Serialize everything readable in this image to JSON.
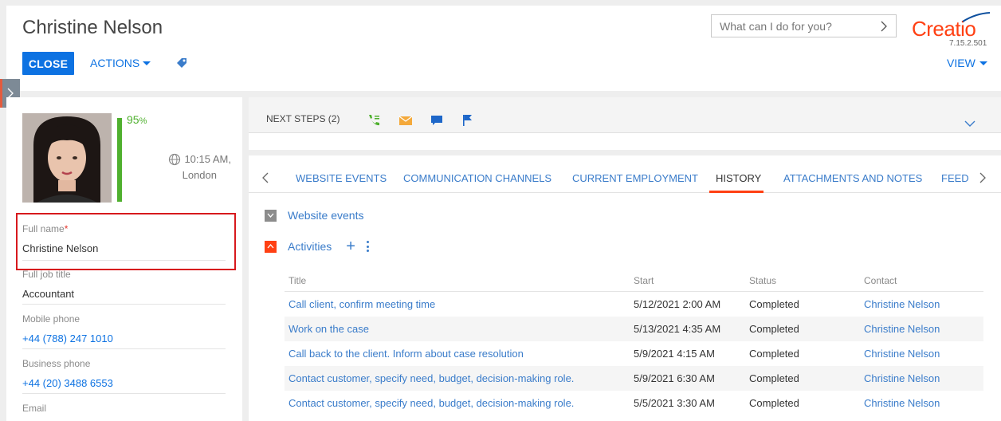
{
  "header": {
    "title": "Christine Nelson",
    "close_label": "CLOSE",
    "actions_label": "ACTIONS",
    "search_placeholder": "What can I do for you?",
    "logo_text": "Creatio",
    "version": "7.15.2.501",
    "view_label": "VIEW",
    "accent_color": "#0d72e2",
    "brand_color": "#ff4013"
  },
  "profile": {
    "completeness": "95",
    "percent_sign": "%",
    "completeness_fraction": 0.95,
    "time": "10:15 AM,",
    "city": "London",
    "fields": [
      {
        "label": "Full name",
        "required_mark": "*",
        "value": "Christine Nelson"
      },
      {
        "label": "Full job title",
        "value": "Accountant"
      },
      {
        "label": "Mobile phone",
        "value": "+44 (788) 247 1010"
      },
      {
        "label": "Business phone",
        "value": "+44 (20) 3488 6553"
      },
      {
        "label": "Email",
        "value": ""
      }
    ]
  },
  "next_steps": {
    "label": "NEXT STEPS (2)",
    "icons": [
      "call-icon",
      "email-icon",
      "chat-icon",
      "flag-icon"
    ]
  },
  "tabs": [
    {
      "label": "WEBSITE EVENTS"
    },
    {
      "label": "COMMUNICATION CHANNELS"
    },
    {
      "label": "CURRENT EMPLOYMENT"
    },
    {
      "label": "HISTORY",
      "active": true
    },
    {
      "label": "ATTACHMENTS AND NOTES"
    },
    {
      "label": "FEED"
    }
  ],
  "history": {
    "website_events_label": "Website events",
    "activities_label": "Activities",
    "columns": [
      "Title",
      "Start",
      "Status",
      "Contact"
    ],
    "rows": [
      {
        "title": "Call client, confirm meeting time",
        "start": "5/12/2021 2:00 AM",
        "status": "Completed",
        "contact": "Christine Nelson"
      },
      {
        "title": "Work on the case",
        "start": "5/13/2021 4:35 AM",
        "status": "Completed",
        "contact": "Christine Nelson"
      },
      {
        "title": "Call back to the client. Inform about case resolution",
        "start": "5/9/2021 4:15 AM",
        "status": "Completed",
        "contact": "Christine Nelson"
      },
      {
        "title": "Contact customer, specify need, budget, decision-making role.",
        "start": "5/9/2021 6:30 AM",
        "status": "Completed",
        "contact": "Christine Nelson"
      },
      {
        "title": "Contact customer, specify need, budget, decision-making role.",
        "start": "5/5/2021 3:30 AM",
        "status": "Completed",
        "contact": "Christine Nelson"
      }
    ]
  }
}
